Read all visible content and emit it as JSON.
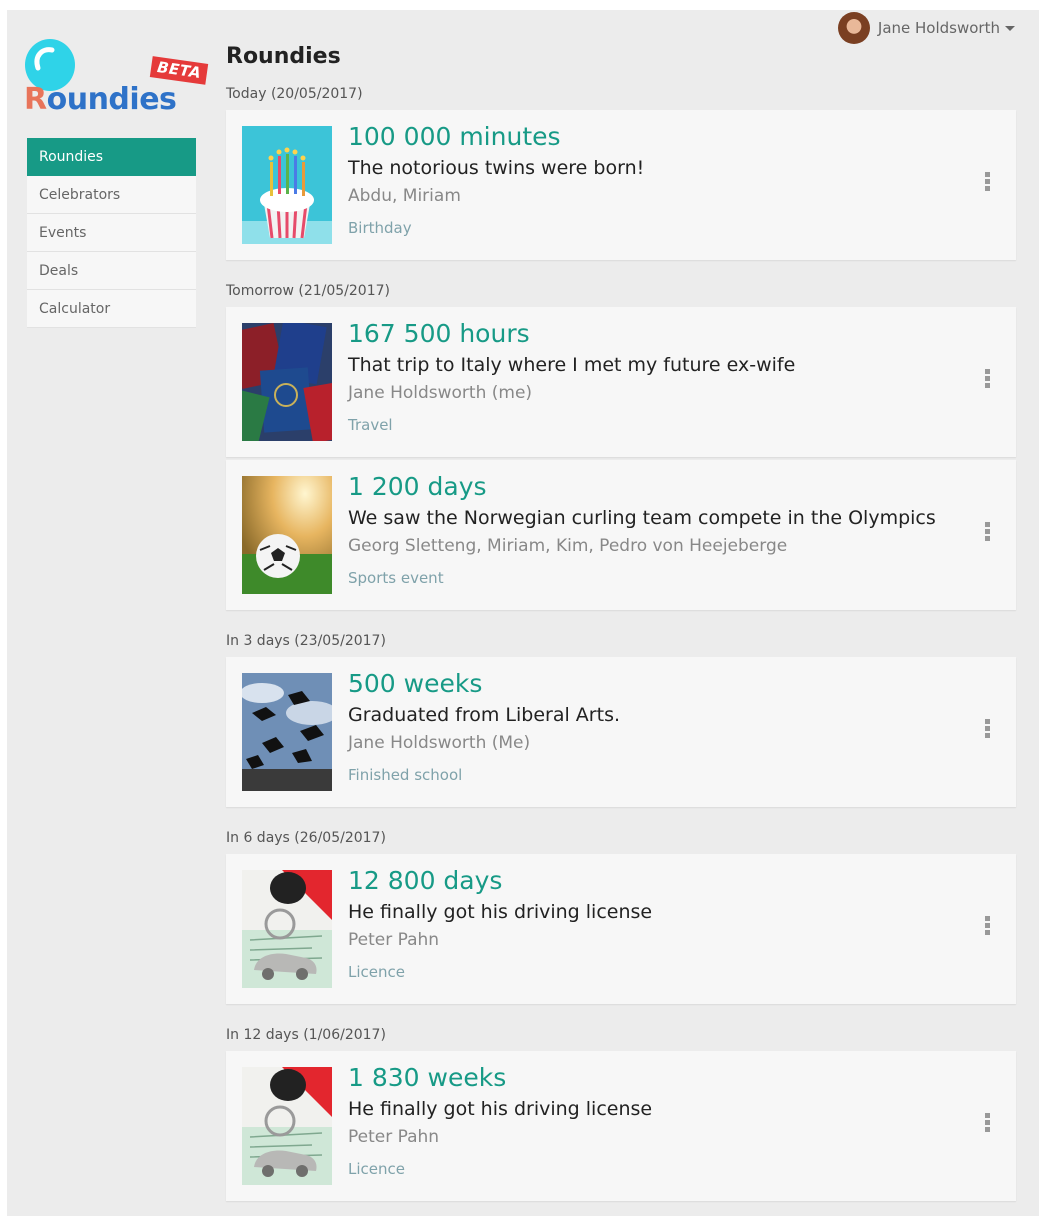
{
  "app": {
    "logo_text_r": "R",
    "logo_text_rest": "oundies",
    "beta_label": "BETA"
  },
  "user": {
    "name": "Jane Holdsworth"
  },
  "sidebar": {
    "items": [
      {
        "label": "Roundies",
        "active": true
      },
      {
        "label": "Celebrators",
        "active": false
      },
      {
        "label": "Events",
        "active": false
      },
      {
        "label": "Deals",
        "active": false
      },
      {
        "label": "Calculator",
        "active": false
      }
    ]
  },
  "main": {
    "title": "Roundies",
    "groups": [
      {
        "label": "Today (20/05/2017)",
        "cards": [
          {
            "value": "100 000 minutes",
            "description": "The notorious twins were born!",
            "people": "Abdu, Miriam",
            "category": "Birthday",
            "thumb": "birthday-cupcake-image"
          }
        ]
      },
      {
        "label": "Tomorrow (21/05/2017)",
        "cards": [
          {
            "value": "167 500 hours",
            "description": "That trip to Italy where I met my future ex-wife",
            "people": "Jane Holdsworth (me)",
            "category": "Travel",
            "thumb": "passports-image"
          },
          {
            "value": "1 200 days",
            "description": "We saw the Norwegian curling team compete in the Olympics",
            "people": "Georg Sletteng, Miriam, Kim, Pedro von Heejeberge",
            "category": "Sports event",
            "thumb": "soccer-ball-image"
          }
        ]
      },
      {
        "label": "In 3 days (23/05/2017)",
        "cards": [
          {
            "value": "500 weeks",
            "description": "Graduated from Liberal Arts.",
            "people": "Jane Holdsworth (Me)",
            "category": "Finished school",
            "thumb": "graduation-caps-image"
          }
        ]
      },
      {
        "label": "In 6 days (26/05/2017)",
        "cards": [
          {
            "value": "12 800 days",
            "description": "He finally got his driving license",
            "people": "Peter Pahn",
            "category": "Licence",
            "thumb": "car-keys-image"
          }
        ]
      },
      {
        "label": "In 12 days (1/06/2017)",
        "cards": [
          {
            "value": "1 830 weeks",
            "description": "He finally got his driving license",
            "people": "Peter Pahn",
            "category": "Licence",
            "thumb": "car-keys-image"
          }
        ]
      }
    ]
  },
  "colors": {
    "accent": "#179a86",
    "logo_blue": "#2e72c8",
    "logo_orange": "#e8745a",
    "beta_red": "#e53a3a",
    "balloon": "#2fd3e8"
  },
  "icons": {
    "card_menu": "more-vertical-icon",
    "user_menu": "caret-down-icon"
  }
}
